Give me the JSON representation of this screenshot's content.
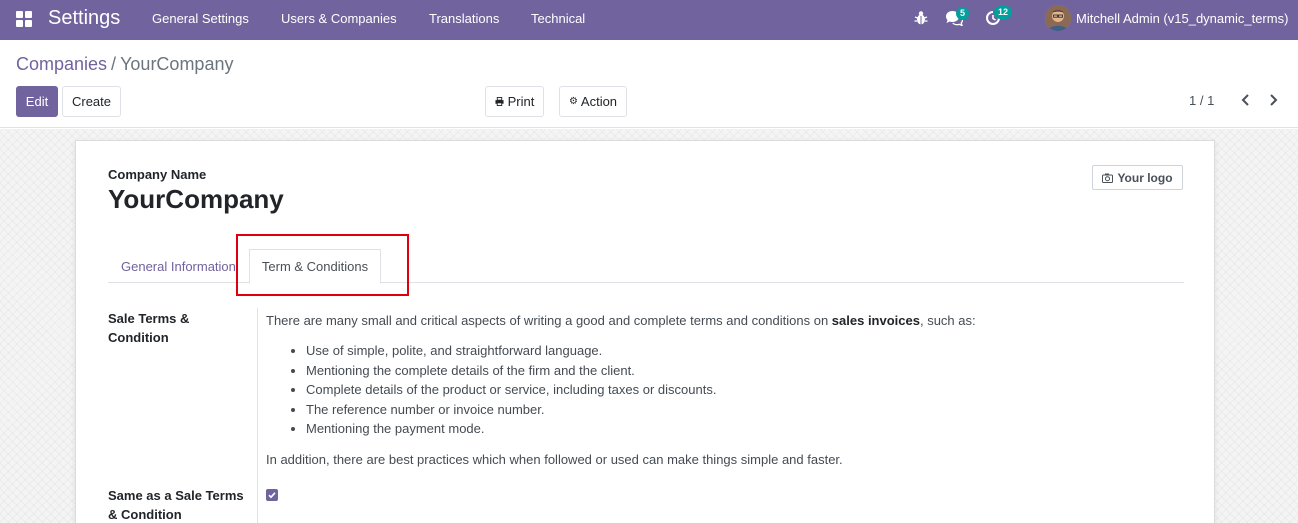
{
  "navbar": {
    "brand": "Settings",
    "menu": [
      "General Settings",
      "Users & Companies",
      "Translations",
      "Technical"
    ],
    "messages_count": "5",
    "activities_count": "12",
    "user": "Mitchell Admin (v15_dynamic_terms)"
  },
  "breadcrumb": {
    "parent": "Companies",
    "separator": "/",
    "current": "YourCompany"
  },
  "buttons": {
    "edit": "Edit",
    "create": "Create",
    "print": "Print",
    "action": "Action"
  },
  "pager": {
    "value": "1 / 1"
  },
  "form": {
    "company_name_label": "Company Name",
    "company_name": "YourCompany",
    "logo_label": "Your logo",
    "tabs": [
      "General Information",
      "Term & Conditions"
    ],
    "active_tab": "Term & Conditions",
    "sale_terms_label": "Sale Terms & Condition",
    "terms_intro_before": "There are many small and critical aspects of writing a good and complete terms and conditions on ",
    "terms_intro_bold": "sales invoices",
    "terms_intro_after": ", such as:",
    "terms_points": [
      "Use of simple, polite, and straightforward language.",
      "Mentioning the complete details of the firm and the client.",
      "Complete details of the product or service, including taxes or discounts.",
      "The reference number or invoice number.",
      "Mentioning the payment mode."
    ],
    "terms_outro": "In addition, there are best practices which when followed or used can make things simple and faster.",
    "same_as_sale_label": "Same as a Sale Terms & Condition",
    "same_as_sale_checked": true
  },
  "colors": {
    "navbar": "#71639e",
    "primary": "#71639e",
    "badge": "#00a09d",
    "highlight": "#e0000d"
  }
}
